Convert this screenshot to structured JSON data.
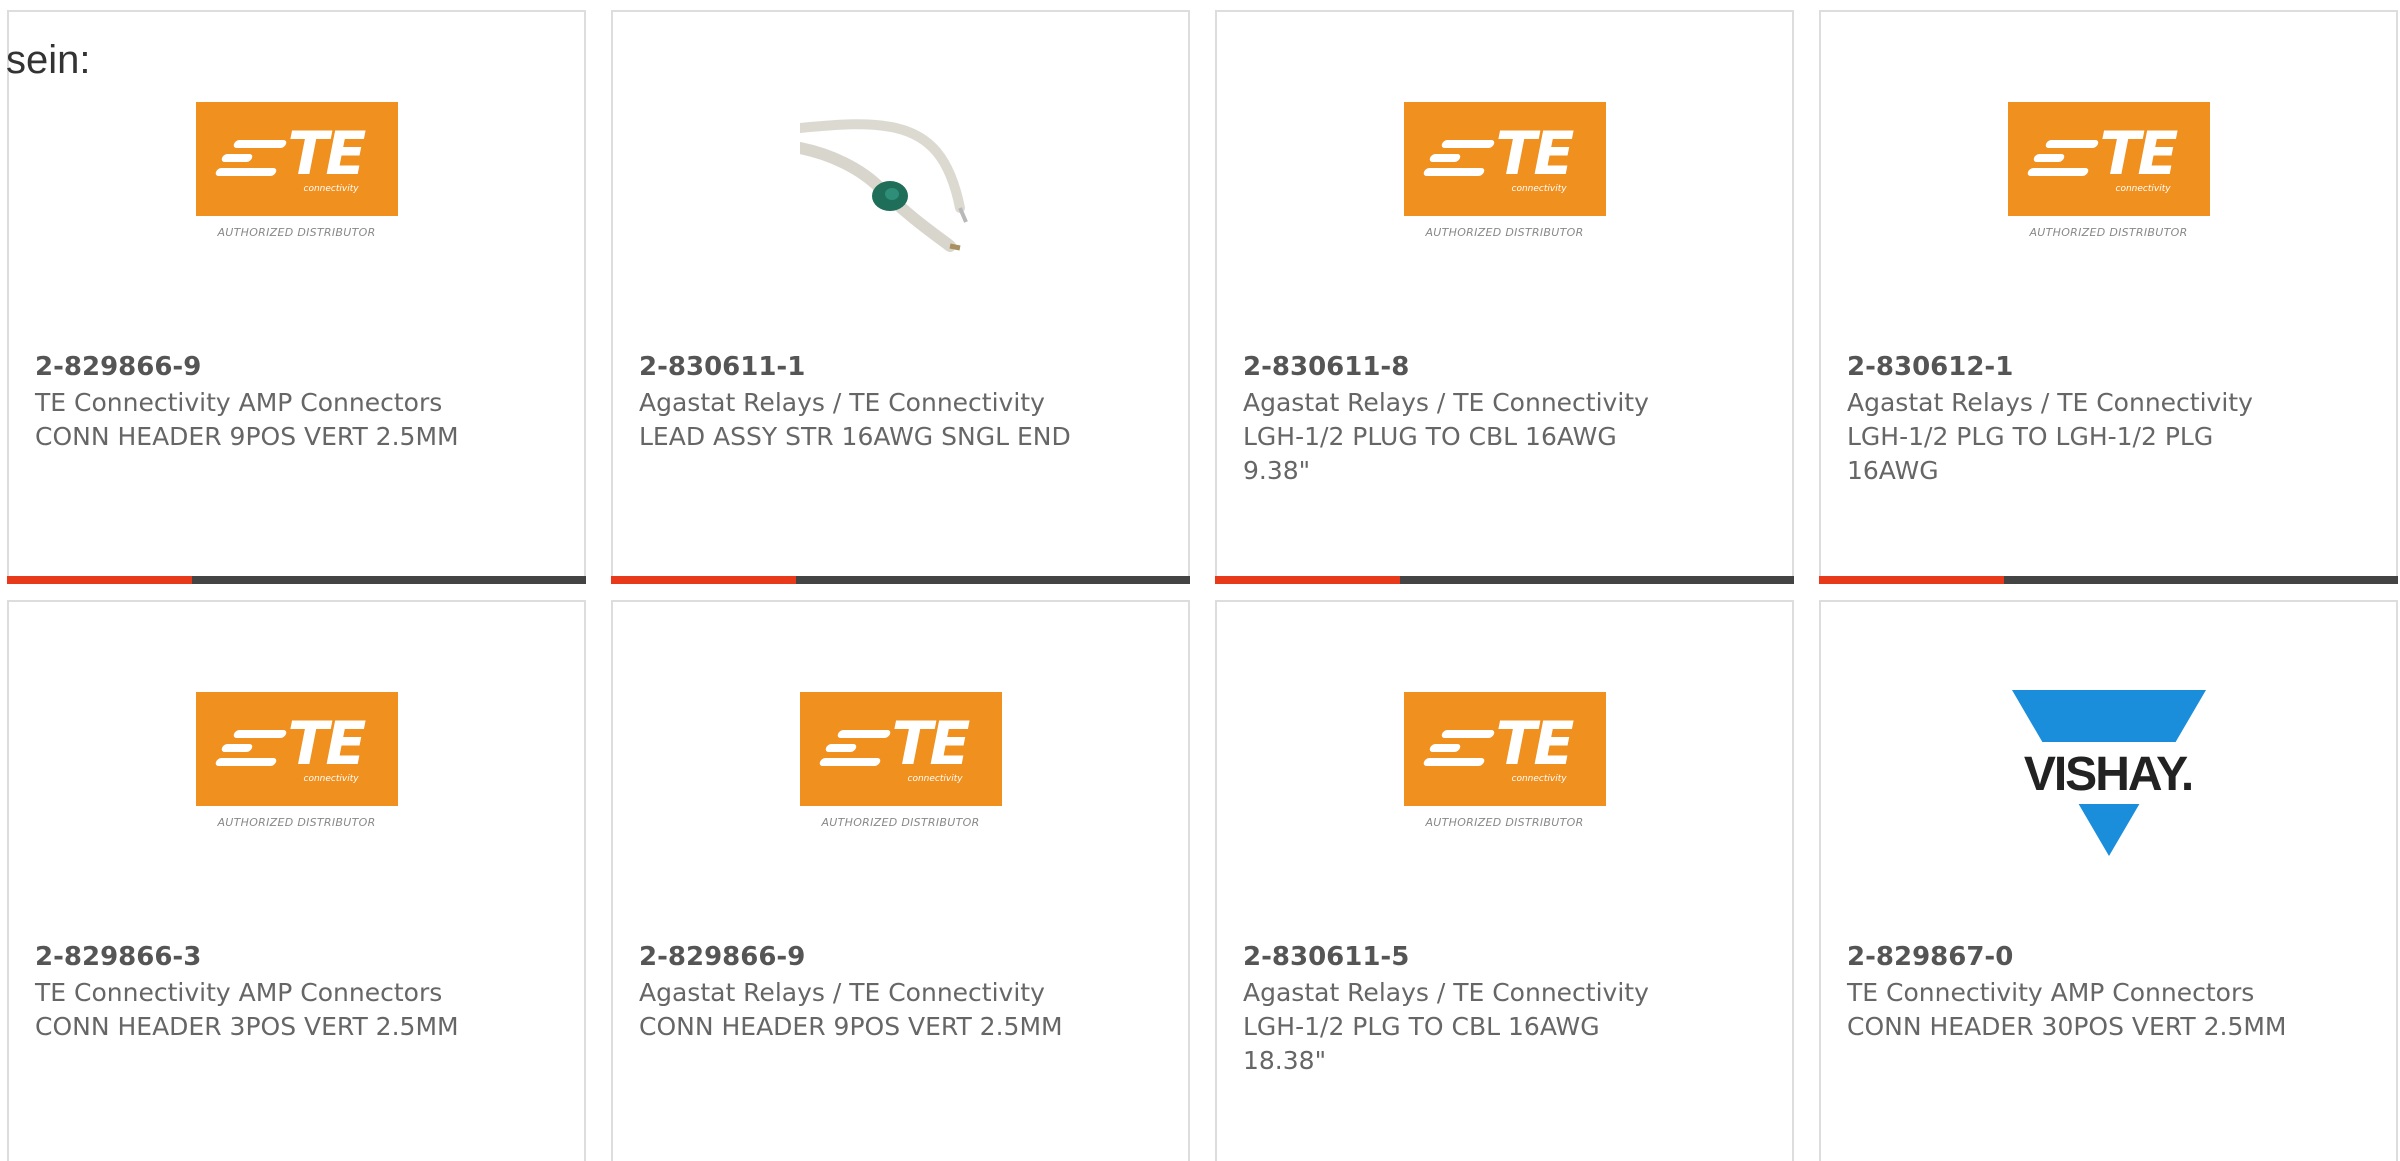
{
  "intro": {
    "text": "sein:"
  },
  "colors": {
    "te_orange": "#f0901e",
    "vishay_blue": "#1a8ddb",
    "progress_active": "#e8391a",
    "progress_track": "#444444"
  },
  "progress_fraction": 0.32,
  "products": [
    {
      "logo": "te-logo",
      "part_number": "2-829866-9",
      "manufacturer": "TE Connectivity AMP Connectors",
      "description": "CONN HEADER 9POS VERT 2.5MM"
    },
    {
      "logo": "cable-image",
      "part_number": "2-830611-1",
      "manufacturer": "Agastat Relays / TE Connectivity",
      "description": "LEAD ASSY STR 16AWG SNGL END"
    },
    {
      "logo": "te-logo",
      "part_number": "2-830611-8",
      "manufacturer": "Agastat Relays / TE Connectivity",
      "description": "LGH-1/2 PLUG TO CBL 16AWG 9.38\""
    },
    {
      "logo": "te-logo",
      "part_number": "2-830612-1",
      "manufacturer": "Agastat Relays / TE Connectivity",
      "description": "LGH-1/2 PLG TO LGH-1/2 PLG 16AWG"
    },
    {
      "logo": "te-logo",
      "part_number": "2-829866-3",
      "manufacturer": "TE Connectivity AMP Connectors",
      "description": "CONN HEADER 3POS VERT 2.5MM"
    },
    {
      "logo": "te-logo",
      "part_number": "2-829866-9",
      "manufacturer": "Agastat Relays / TE Connectivity",
      "description": "CONN HEADER 9POS VERT 2.5MM"
    },
    {
      "logo": "te-logo",
      "part_number": "2-830611-5",
      "manufacturer": "Agastat Relays / TE Connectivity",
      "description": "LGH-1/2 PLG TO CBL 16AWG 18.38\""
    },
    {
      "logo": "vishay-logo",
      "part_number": "2-829867-0",
      "manufacturer": "TE Connectivity AMP Connectors",
      "description": "CONN HEADER 30POS VERT 2.5MM"
    }
  ],
  "te_logo": {
    "brand": "TE",
    "sub": "connectivity",
    "authorized": "AUTHORIZED DISTRIBUTOR"
  },
  "vishay_logo": {
    "brand": "VISHAY."
  }
}
